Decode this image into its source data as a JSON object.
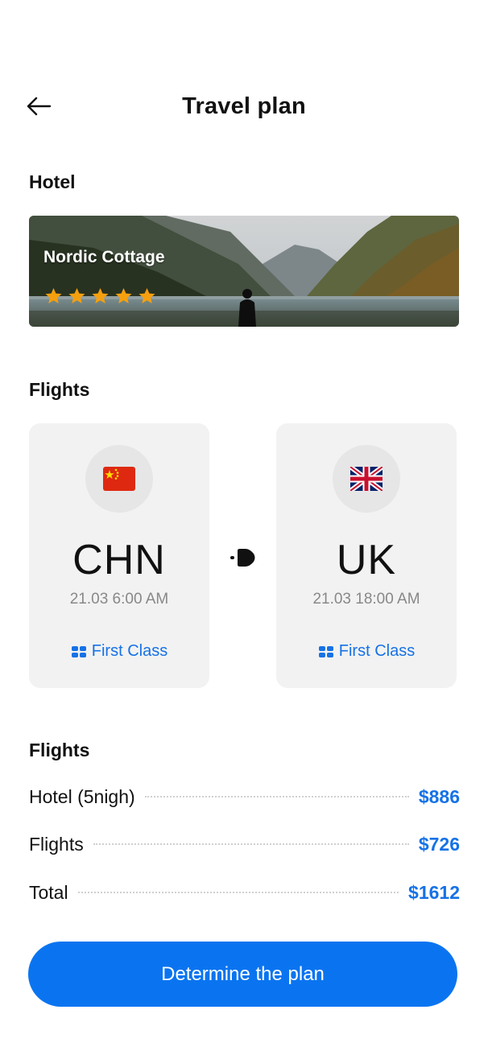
{
  "header": {
    "title": "Travel plan",
    "back_icon": "arrow-left-icon"
  },
  "hotel": {
    "section_title": "Hotel",
    "name": "Nordic Cottage",
    "rating": 5,
    "star_color": "#f5a00f"
  },
  "flights": {
    "section_title": "Flights",
    "from": {
      "flag": "🇨🇳",
      "code": "CHN",
      "time": "21.03 6:00 AM",
      "class_label": "First Class"
    },
    "to": {
      "flag": "🇬🇧",
      "code": "UK",
      "time": "21.03 18:00 AM",
      "class_label": "First Class"
    }
  },
  "summary": {
    "section_title": "Flights",
    "rows": [
      {
        "label": "Hotel (5nigh)",
        "value": "$886"
      },
      {
        "label": "Flights",
        "value": "$726"
      },
      {
        "label": "Total",
        "value": "$1612"
      }
    ]
  },
  "cta": {
    "label": "Determine the plan"
  },
  "colors": {
    "accent": "#0a74f0",
    "link": "#1672e6",
    "card_bg": "#f2f2f2"
  }
}
